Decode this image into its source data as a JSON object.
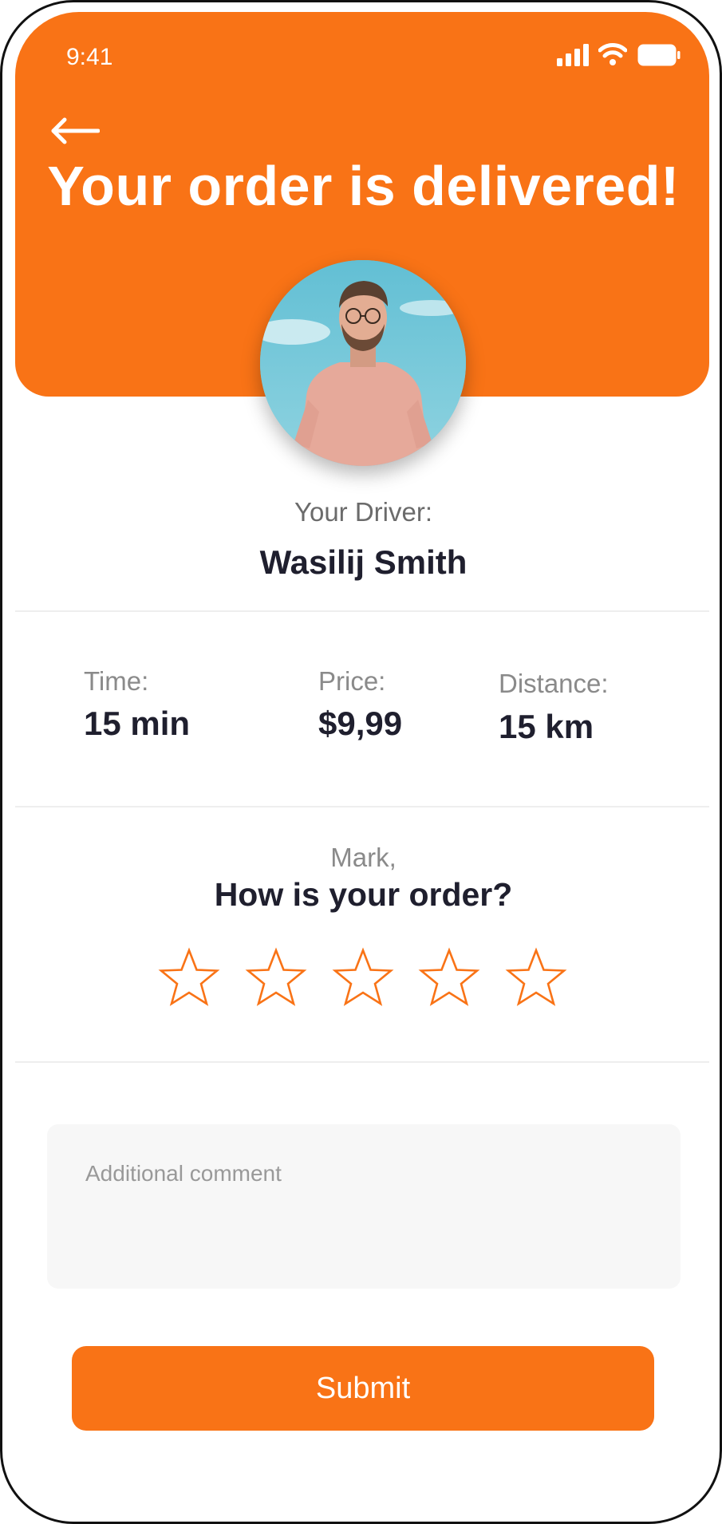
{
  "status_bar": {
    "time": "9:41",
    "icons": [
      "cellular-signal-icon",
      "wifi-icon",
      "battery-icon"
    ]
  },
  "header": {
    "back_icon": "back-arrow-icon",
    "title": "Your order is delivered!"
  },
  "driver": {
    "label": "Your Driver:",
    "name": "Wasilij Smith"
  },
  "stats": [
    {
      "label": "Time:",
      "value": "15 min"
    },
    {
      "label": "Price:",
      "value": "$9,99"
    },
    {
      "label": "Distance:",
      "value": "15 km"
    }
  ],
  "rating": {
    "customer_name": "Mark,",
    "question": "How is your order?",
    "max_stars": 5,
    "selected_stars": 0
  },
  "comment": {
    "placeholder": "Additional comment",
    "value": ""
  },
  "submit_label": "Submit",
  "colors": {
    "accent": "#F97316",
    "text_dark": "#1F1F2E",
    "text_muted": "#8A8A8A"
  }
}
